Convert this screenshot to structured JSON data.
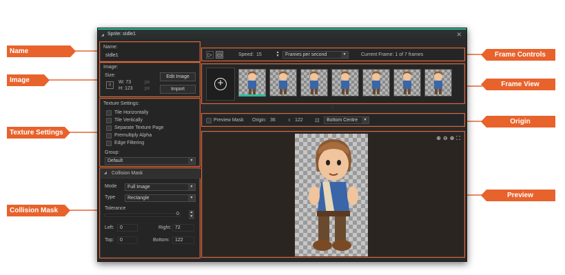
{
  "window": {
    "title": "Sprite: sIdle1",
    "close_icon": "close-icon"
  },
  "name_panel": {
    "label": "Name:",
    "value": "sIdle1"
  },
  "image_panel": {
    "label": "Image:",
    "size_label": "Size:",
    "width": "W: 73",
    "height": "H: 123",
    "px1": "px",
    "px2": "px",
    "edit_button": "Edit Image",
    "import_button": "Import"
  },
  "texture_panel": {
    "label": "Texture Settings:",
    "options": [
      "Tile Horizontally",
      "Tile Vertically",
      "Separate Texture Page",
      "Premultiply Alpha",
      "Edge Filtering"
    ],
    "group_label": "Group:",
    "group_value": "Default"
  },
  "collision_panel": {
    "title": "Collision Mask",
    "mode_label": "Mode",
    "mode_value": "Full Image",
    "type_label": "Type",
    "type_value": "Rectangle",
    "tolerance_label": "Tolerance",
    "tolerance_value": "0",
    "left_label": "Left:",
    "left_value": "0",
    "right_label": "Right:",
    "right_value": "72",
    "top_label": "Top:",
    "top_value": "0",
    "bottom_label": "Bottom:",
    "bottom_value": "122"
  },
  "frame_controls": {
    "speed_label": "Speed:",
    "speed_value": "15",
    "speed_unit": "Frames per second",
    "current_frame": "Current Frame: 1 of 7 frames"
  },
  "frame_view": {
    "add_icon": "plus-icon",
    "frame_count": 7,
    "selected_frame": 1
  },
  "origin_bar": {
    "preview_mask": "Preview Mask",
    "origin_label": "Origin:",
    "origin_x": "36",
    "origin_sep": "x",
    "origin_y": "122",
    "origin_preset": "Bottom Centre"
  },
  "callouts": {
    "name": "Name",
    "image": "Image",
    "texture": "Texture Settings",
    "collision": "Collision Mask",
    "frame_controls": "Frame Controls",
    "frame_view": "Frame View",
    "origin": "Origin",
    "preview": "Preview"
  },
  "colors": {
    "accent": "#e8622c",
    "teal": "#2bbf9c",
    "panel": "#252525"
  }
}
